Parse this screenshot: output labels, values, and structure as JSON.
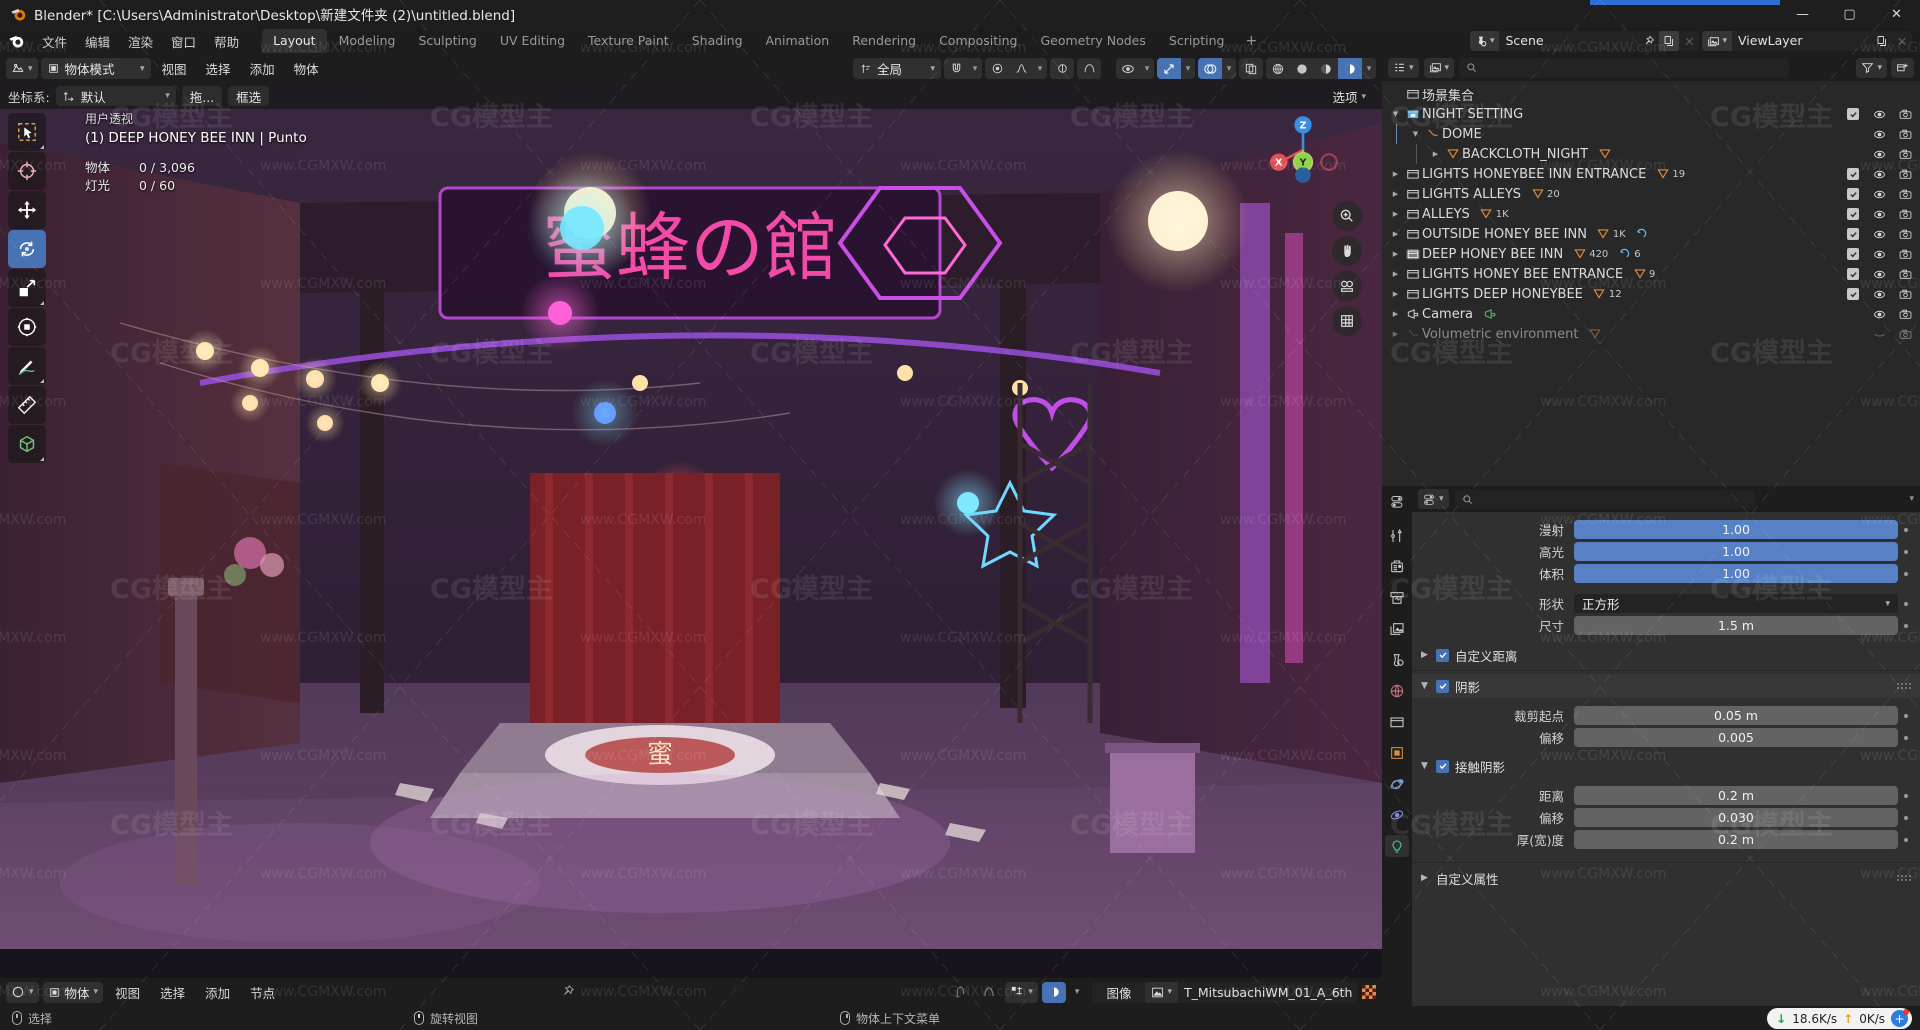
{
  "window": {
    "title": "Blender* [C:\\Users\\Administrator\\Desktop\\新建文件夹 (2)\\untitled.blend]",
    "minimize": "—",
    "maximize": "▢",
    "close": "✕"
  },
  "menubar": {
    "items": [
      "文件",
      "编辑",
      "渲染",
      "窗口",
      "帮助"
    ],
    "tabs": [
      "Layout",
      "Modeling",
      "Sculpting",
      "UV Editing",
      "Texture Paint",
      "Shading",
      "Animation",
      "Rendering",
      "Compositing",
      "Geometry Nodes",
      "Scripting"
    ],
    "active_tab": "Layout",
    "add_tab": "+",
    "scene_name": "Scene",
    "viewlayer_name": "ViewLayer"
  },
  "viewport_header": {
    "mode": "物体模式",
    "menus": [
      "视图",
      "选择",
      "添加",
      "物体"
    ],
    "transform_orientation": "全局",
    "options_label": "选项"
  },
  "viewport_subheader": {
    "coord_label": "坐标系:",
    "coord_value": "默认",
    "drag_label": "拖...",
    "box_select": "框选"
  },
  "viewport_overlay": {
    "view_name": "用户透视",
    "active_object": "(1) DEEP HONEY BEE INN | Punto",
    "stats": [
      {
        "key": "物体",
        "value": "0 / 3,096"
      },
      {
        "key": "灯光",
        "value": "0 / 60"
      }
    ],
    "gizmo_axes": [
      "X",
      "Y",
      "Z"
    ]
  },
  "bottom_editor": {
    "mode": "物体",
    "menus": [
      "视图",
      "选择",
      "添加",
      "节点"
    ],
    "image_label": "图像",
    "image_name": "T_MitsubachiWM_01_A_6th"
  },
  "outliner": {
    "display_mode": "view-layer",
    "search_placeholder": "",
    "root": "场景集合",
    "rows": [
      {
        "label": "NIGHT SETTING",
        "indent": 0,
        "icon": "collection-active",
        "disclosure": "open",
        "checkbox": true,
        "eye": true,
        "camera": true,
        "selected": false,
        "badges": []
      },
      {
        "label": "DOME",
        "indent": 1,
        "icon": "light",
        "disclosure": "open",
        "checkbox": false,
        "eye": true,
        "camera": true,
        "selected": false,
        "badges": []
      },
      {
        "label": "BACKCLOTH_NIGHT",
        "indent": 2,
        "icon": "light-data",
        "disclosure": "closed",
        "checkbox": false,
        "eye": true,
        "camera": true,
        "selected": false,
        "badges": [
          {
            "icon": "mesh-data",
            "text": ""
          }
        ]
      },
      {
        "label": "LIGHTS HONEYBEE INN ENTRANCE",
        "indent": 0,
        "icon": "collection",
        "disclosure": "closed",
        "checkbox": true,
        "eye": true,
        "camera": true,
        "selected": false,
        "badges": [
          {
            "icon": "light-data",
            "text": "19"
          }
        ]
      },
      {
        "label": "LIGHTS ALLEYS",
        "indent": 0,
        "icon": "collection",
        "disclosure": "closed",
        "checkbox": true,
        "eye": true,
        "camera": true,
        "selected": false,
        "badges": [
          {
            "icon": "light-data",
            "text": "20"
          }
        ]
      },
      {
        "label": "ALLEYS",
        "indent": 0,
        "icon": "collection",
        "disclosure": "closed",
        "checkbox": true,
        "eye": true,
        "camera": true,
        "selected": false,
        "badges": [
          {
            "icon": "mesh-data",
            "text": "1K"
          }
        ]
      },
      {
        "label": "OUTSIDE HONEY BEE INN",
        "indent": 0,
        "icon": "collection",
        "disclosure": "closed",
        "checkbox": true,
        "eye": true,
        "camera": true,
        "selected": false,
        "badges": [
          {
            "icon": "mesh-data",
            "text": "1K"
          },
          {
            "icon": "modifier",
            "text": ""
          }
        ]
      },
      {
        "label": "DEEP HONEY BEE INN",
        "indent": 0,
        "icon": "collection-hl",
        "disclosure": "closed",
        "checkbox": true,
        "eye": true,
        "camera": true,
        "selected": false,
        "badges": [
          {
            "icon": "mesh-data",
            "text": "420"
          },
          {
            "icon": "modifier",
            "text": "6"
          }
        ]
      },
      {
        "label": "LIGHTS HONEY BEE ENTRANCE",
        "indent": 0,
        "icon": "collection",
        "disclosure": "closed",
        "checkbox": true,
        "eye": true,
        "camera": true,
        "selected": false,
        "badges": [
          {
            "icon": "light-data",
            "text": "9"
          }
        ]
      },
      {
        "label": "LIGHTS DEEP HONEYBEE",
        "indent": 0,
        "icon": "collection",
        "disclosure": "closed",
        "checkbox": true,
        "eye": true,
        "camera": true,
        "selected": false,
        "badges": [
          {
            "icon": "light-data",
            "text": "12"
          }
        ]
      },
      {
        "label": "Camera",
        "indent": 0,
        "icon": "camera-obj",
        "disclosure": "closed",
        "checkbox": false,
        "eye": true,
        "camera": true,
        "selected": false,
        "badges": [
          {
            "icon": "camera-data",
            "text": ""
          }
        ]
      },
      {
        "label": "Volumetric environment",
        "indent": 0,
        "icon": "light-dim",
        "disclosure": "closed",
        "checkbox": false,
        "eye": "off",
        "camera": true,
        "selected": false,
        "dim": true,
        "badges": [
          {
            "icon": "light-data",
            "text": ""
          }
        ]
      }
    ]
  },
  "properties": {
    "tabs": [
      "tool-icon",
      "render-icon",
      "output-icon",
      "viewlayer-icon",
      "scene-icon",
      "world-icon",
      "collection-icon",
      "object-icon",
      "modifier-icon",
      "physics-icon",
      "data-light-icon"
    ],
    "active_tab_index": 10,
    "fields": [
      {
        "label": "漫射",
        "value": "1.00",
        "type": "slider"
      },
      {
        "label": "高光",
        "value": "1.00",
        "type": "slider"
      },
      {
        "label": "体积",
        "value": "1.00",
        "type": "slider"
      }
    ],
    "shape": {
      "label": "形状",
      "value": "正方形",
      "type": "dropdown"
    },
    "size": {
      "label": "尺寸",
      "value": "1.5 m",
      "type": "value"
    },
    "custom_distance": {
      "label": "自定义距离",
      "checked": true,
      "open": false
    },
    "shadow_panel": {
      "label": "阴影",
      "checked": true,
      "open": true
    },
    "shadow_fields": [
      {
        "label": "裁剪起点",
        "value": "0.05 m"
      },
      {
        "label": "偏移",
        "value": "0.005"
      }
    ],
    "contact_shadow_panel": {
      "label": "接触阴影",
      "checked": true,
      "open": true
    },
    "contact_fields": [
      {
        "label": "距离",
        "value": "0.2 m"
      },
      {
        "label": "偏移",
        "value": "0.030"
      },
      {
        "label": "厚(宽)度",
        "value": "0.2 m"
      }
    ],
    "custom_props": {
      "label": "自定义属性",
      "open": false
    }
  },
  "statusbar": {
    "items": [
      {
        "icon": "mouse-left",
        "label": "选择"
      },
      {
        "icon": "mouse-middle",
        "label": "旋转视图"
      },
      {
        "icon": "mouse-right",
        "label": "物体上下文菜单"
      }
    ],
    "network": {
      "down": "18.6K/s",
      "up": "0K/s",
      "down_arrow": "↓",
      "up_arrow": "↑",
      "plus": "+"
    }
  },
  "watermark": {
    "text": "www.CGMXW.com",
    "logo": "CG模型主"
  },
  "colors": {
    "accent_blue": "#4772b3",
    "slider_blue": "#5781c4",
    "header_bg": "#1d1d1d",
    "panel_bg": "#303030",
    "outliner_bg": "#282828",
    "axis_x": "#e05252",
    "axis_y": "#8bd442",
    "axis_z": "#3b8fe0"
  }
}
